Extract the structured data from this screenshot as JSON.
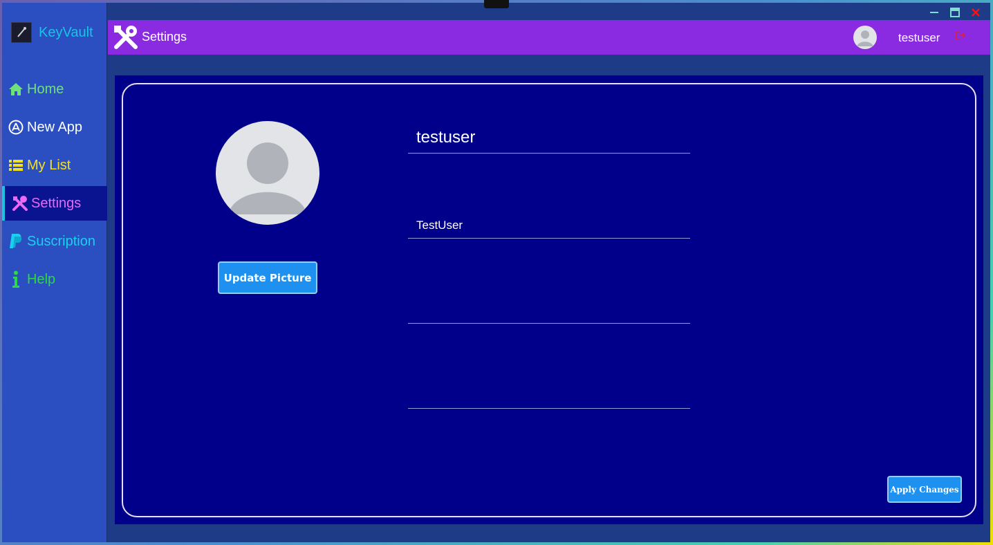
{
  "app": {
    "name": "KeyVault"
  },
  "sidebar": {
    "items": [
      {
        "label": "Home",
        "icon": "home-icon",
        "color": "#6fe07a"
      },
      {
        "label": "New App",
        "icon": "app-store-icon",
        "color": "#ffffff"
      },
      {
        "label": "My List",
        "icon": "list-icon",
        "color": "#f5e11b"
      },
      {
        "label": "Settings",
        "icon": "tools-icon",
        "color": "#e86af5",
        "active": true
      },
      {
        "label": "Suscription",
        "icon": "paypal-icon",
        "color": "#19d0ef"
      },
      {
        "label": "Help",
        "icon": "info-icon",
        "color": "#2ed64a"
      }
    ]
  },
  "header": {
    "title": "Settings",
    "username": "testuser",
    "accent": "#8a2be2"
  },
  "profile": {
    "username_value": "testuser",
    "display_name_value": "TestUser",
    "field3_value": "",
    "field4_value": "",
    "update_picture_label": "Update Picture",
    "apply_changes_label": "Apply Changes"
  },
  "colors": {
    "content_bg": "#01008a",
    "button": "#1e90f0"
  }
}
